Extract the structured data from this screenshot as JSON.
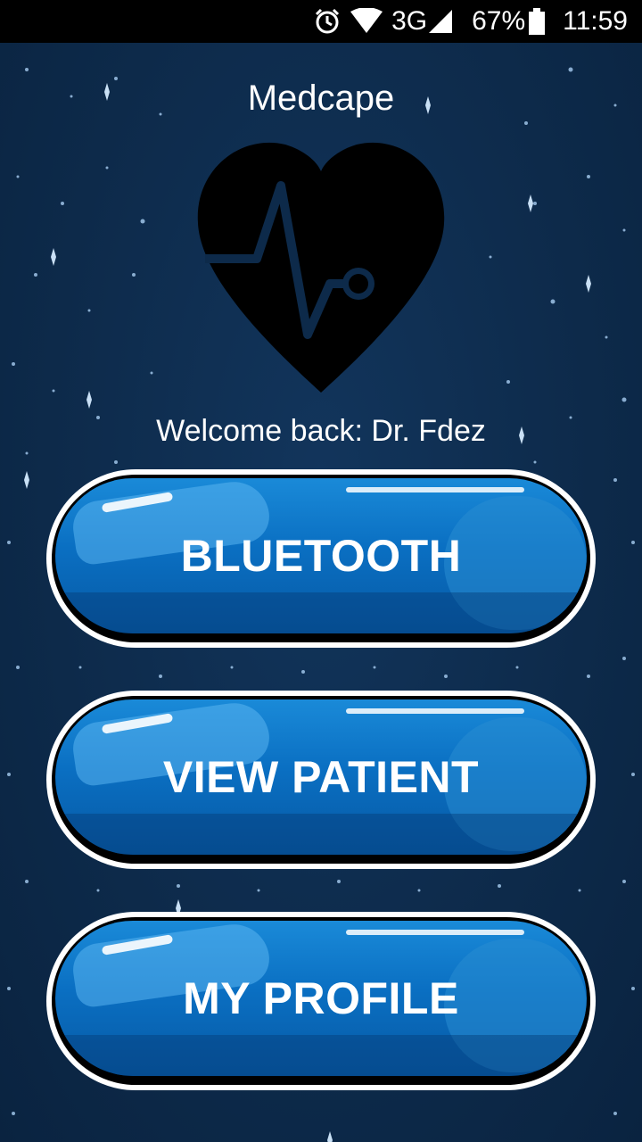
{
  "status_bar": {
    "network": "3G",
    "battery": "67%",
    "time": "11:59",
    "icons": [
      "alarm-icon",
      "wifi-icon",
      "signal-icon",
      "battery-icon"
    ]
  },
  "app": {
    "title": "Medcape",
    "logo_icon": "heart-pulse-icon",
    "welcome": "Welcome back: Dr. Fdez"
  },
  "buttons": [
    {
      "label": "BLUETOOTH"
    },
    {
      "label": "VIEW PATIENT"
    },
    {
      "label": "MY PROFILE"
    }
  ],
  "colors": {
    "background": "#0d2a4a",
    "button_blue": "#0a6fc2",
    "status_bar": "#000000"
  }
}
